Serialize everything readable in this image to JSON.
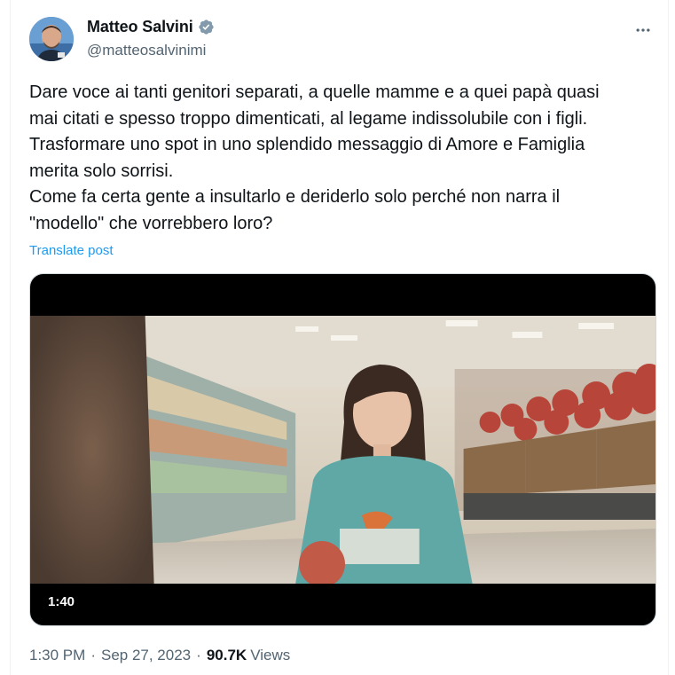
{
  "author": {
    "name": "Matteo Salvini",
    "handle": "@matteosalvinimi",
    "verified_color": "#829aab"
  },
  "tweet": {
    "text": "Dare voce ai tanti genitori separati, a quelle mamme e a quei papà quasi\nmai citati e spesso troppo dimenticati, al legame indissolubile con i figli.\nTrasformare uno spot in uno splendido messaggio di Amore e Famiglia\nmerita solo sorrisi.\nCome fa certa gente a insultarlo e deriderlo solo perché non narra il\n\"modello\" che vorrebbero loro?",
    "translate_label": "Translate post"
  },
  "media": {
    "type": "video",
    "duration": "1:40"
  },
  "meta": {
    "time": "1:30 PM",
    "date": "Sep 27, 2023",
    "separator": "·",
    "views_count": "90.7K",
    "views_label": "Views"
  },
  "colors": {
    "link": "#1d9bf0",
    "secondary_text": "#536471",
    "primary_text": "#0f1419"
  }
}
